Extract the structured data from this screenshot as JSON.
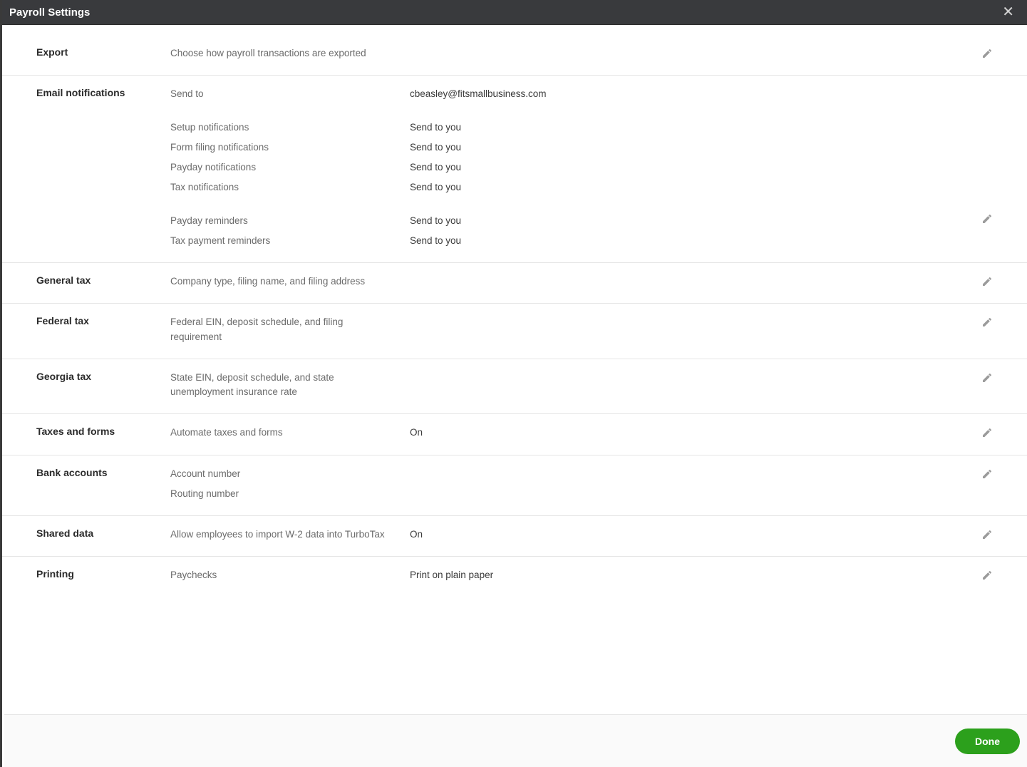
{
  "header": {
    "title": "Payroll Settings"
  },
  "buttons": {
    "done": "Done"
  },
  "sections": {
    "export": {
      "title": "Export",
      "desc": "Choose how payroll transactions are exported"
    },
    "email": {
      "title": "Email notifications",
      "send_to_label": "Send to",
      "send_to_value": "cbeasley@fitsmallbusiness.com",
      "rows": [
        {
          "label": "Setup notifications",
          "value": "Send to you"
        },
        {
          "label": "Form filing notifications",
          "value": "Send to you"
        },
        {
          "label": "Payday notifications",
          "value": "Send to you"
        },
        {
          "label": "Tax notifications",
          "value": "Send to you"
        }
      ],
      "rows2": [
        {
          "label": "Payday reminders",
          "value": "Send to you"
        },
        {
          "label": "Tax payment reminders",
          "value": "Send to you"
        }
      ]
    },
    "general_tax": {
      "title": "General tax",
      "desc": "Company type, filing name, and filing address"
    },
    "federal_tax": {
      "title": "Federal tax",
      "desc": "Federal EIN, deposit schedule, and filing requirement"
    },
    "georgia_tax": {
      "title": "Georgia tax",
      "desc": "State EIN, deposit schedule, and state unemployment insurance rate"
    },
    "taxes_forms": {
      "title": "Taxes and forms",
      "label": "Automate taxes and forms",
      "value": "On"
    },
    "bank": {
      "title": "Bank accounts",
      "rows": [
        {
          "label": "Account number"
        },
        {
          "label": "Routing number"
        }
      ]
    },
    "shared": {
      "title": "Shared data",
      "label": "Allow employees to import W-2 data into TurboTax",
      "value": "On"
    },
    "printing": {
      "title": "Printing",
      "label": "Paychecks",
      "value": "Print on plain paper"
    }
  }
}
